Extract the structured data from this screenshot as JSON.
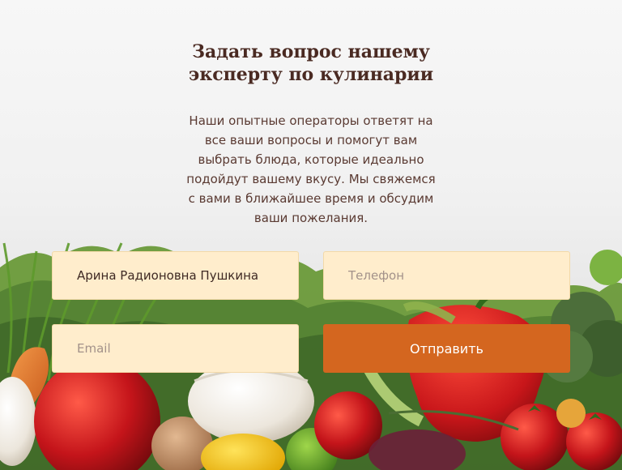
{
  "form": {
    "title_line1": "Задать вопрос нашему",
    "title_line2": "эксперту по кулинарии",
    "description": "Наши опытные операторы ответят на все ваши вопросы и помогут вам выбрать блюда, которые идеально подойдут вашему вкусу. Мы свяжемся с вами в ближайшее время и обсудим ваши пожелания.",
    "name_value": "Арина Радионовна Пушкина",
    "phone_placeholder": "Телефон",
    "email_placeholder": "Email",
    "submit_label": "Отправить"
  },
  "colors": {
    "accent": "#d4661f",
    "field_background": "#ffedcc",
    "heading": "#4a2a22"
  }
}
